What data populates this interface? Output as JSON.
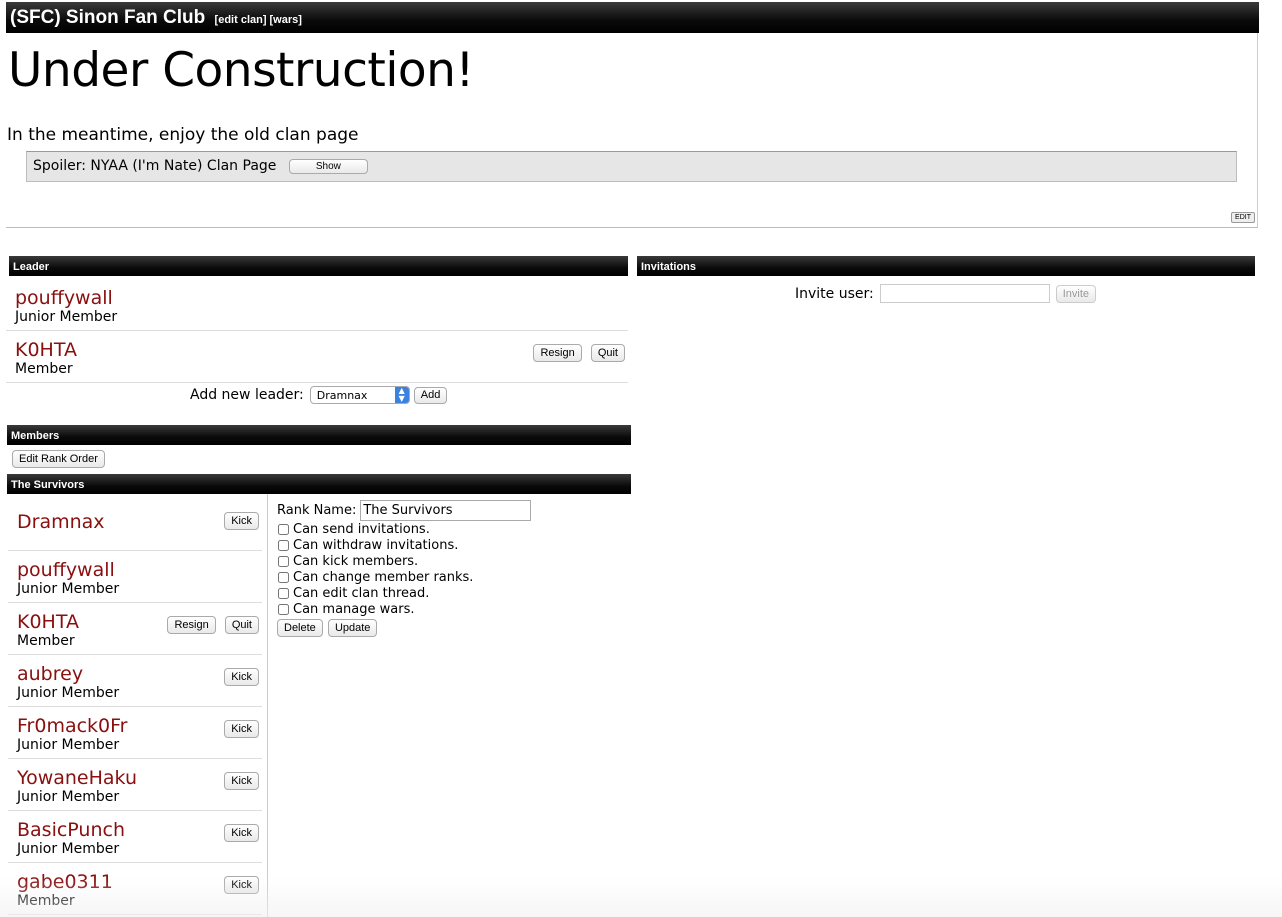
{
  "header": {
    "title": "(SFC) Sinon Fan Club",
    "edit_clan": "[edit clan]",
    "wars": "[wars]"
  },
  "clan_page": {
    "heading": "Under Construction!",
    "subtext": "In the meantime, enjoy the old clan page",
    "spoiler_label": "Spoiler: NYAA (I'm Nate) Clan Page",
    "spoiler_button": "Show",
    "edit_button": "EDIT"
  },
  "leader": {
    "title": "Leader",
    "people": [
      {
        "name": "pouffywall",
        "rank": "Junior Member",
        "buttons": []
      },
      {
        "name": "K0HTA",
        "rank": "Member",
        "buttons": [
          "Resign",
          "Quit"
        ]
      }
    ],
    "add_label": "Add new leader:",
    "add_select": "Dramnax",
    "add_button": "Add"
  },
  "invitations": {
    "title": "Invitations",
    "label": "Invite user:",
    "value": "",
    "button": "Invite"
  },
  "members": {
    "title": "Members",
    "edit_rank_order": "Edit Rank Order"
  },
  "rank": {
    "title": "The Survivors",
    "members": [
      {
        "name": "Dramnax",
        "rank": "",
        "buttons": [
          "Kick"
        ]
      },
      {
        "name": "pouffywall",
        "rank": "Junior Member",
        "buttons": []
      },
      {
        "name": "K0HTA",
        "rank": "Member",
        "buttons": [
          "Resign",
          "Quit"
        ]
      },
      {
        "name": "aubrey",
        "rank": "Junior Member",
        "buttons": [
          "Kick"
        ]
      },
      {
        "name": "Fr0mack0Fr",
        "rank": "Junior Member",
        "buttons": [
          "Kick"
        ]
      },
      {
        "name": "YowaneHaku",
        "rank": "Junior Member",
        "buttons": [
          "Kick"
        ]
      },
      {
        "name": "BasicPunch",
        "rank": "Junior Member",
        "buttons": [
          "Kick"
        ]
      },
      {
        "name": "gabe0311",
        "rank": "Member",
        "buttons": [
          "Kick"
        ]
      }
    ],
    "form": {
      "rank_name_label": "Rank Name:",
      "rank_name_value": "The Survivors",
      "permissions": [
        {
          "label": "Can send invitations.",
          "checked": false
        },
        {
          "label": "Can withdraw invitations.",
          "checked": false
        },
        {
          "label": "Can kick members.",
          "checked": false
        },
        {
          "label": "Can change member ranks.",
          "checked": false
        },
        {
          "label": "Can edit clan thread.",
          "checked": false
        },
        {
          "label": "Can manage wars.",
          "checked": false
        }
      ],
      "delete_button": "Delete",
      "update_button": "Update"
    }
  }
}
